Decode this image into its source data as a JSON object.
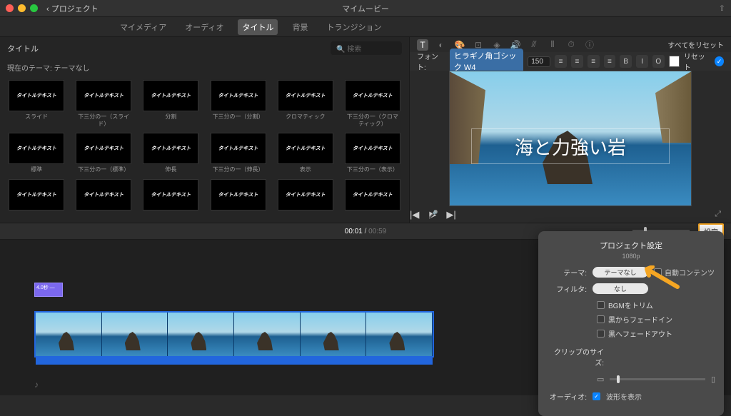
{
  "titlebar": {
    "back": "プロジェクト",
    "title": "マイムービー"
  },
  "tabs": {
    "media": "マイメディア",
    "audio": "オーディオ",
    "titles": "タイトル",
    "bg": "背景",
    "trans": "トランジション"
  },
  "browser": {
    "label": "タイトル",
    "search_ph": "検索",
    "theme_label": "現在のテーマ: テーマなし",
    "placeholder_text": "タイトルテキスト",
    "thumbs": [
      "スライド",
      "下三分の一（スライド）",
      "分割",
      "下三分の一（分割）",
      "クロマティック",
      "下三分の一（クロマティック）",
      "標準",
      "下三分の一（標準）",
      "伸長",
      "下三分の一（伸長）",
      "表示",
      "下三分の一（表示）",
      "",
      "",
      "",
      "",
      "",
      ""
    ]
  },
  "inspector": {
    "reset_all": "すべてをリセット"
  },
  "fontbar": {
    "label": "フォント:",
    "font": "ヒラギノ角ゴシック W4",
    "size": "150",
    "b": "B",
    "i": "I",
    "o": "O",
    "reset": "リセット"
  },
  "preview": {
    "overlay_text": "海と力強い岩"
  },
  "timebar": {
    "current": "00:01",
    "duration": "00:59",
    "settings": "設定"
  },
  "timeline": {
    "clip_label": "4.0秒 —"
  },
  "popover": {
    "title": "プロジェクト設定",
    "sub": "1080p",
    "theme_label": "テーマ:",
    "theme_value": "テーマなし",
    "auto_label": "自動コンテンツ",
    "filter_label": "フィルタ:",
    "filter_value": "なし",
    "chk_bgm": "BGMをトリム",
    "chk_fadein": "黒からフェードイン",
    "chk_fadeout": "黒へフェードアウト",
    "clipsize_label": "クリップのサイズ:",
    "audio_label": "オーディオ:",
    "waveform": "波形を表示"
  }
}
